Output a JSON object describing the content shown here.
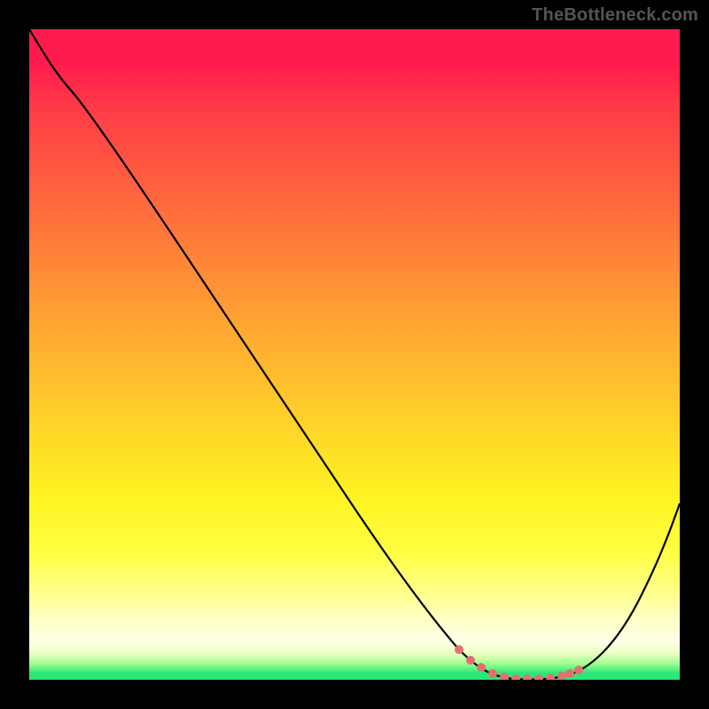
{
  "watermark": "TheBottleneck.com",
  "chart_data": {
    "type": "line",
    "title": "",
    "xlabel": "",
    "ylabel": "",
    "xlim": [
      0,
      100
    ],
    "ylim": [
      0,
      100
    ],
    "series": [
      {
        "name": "bottleneck-curve",
        "x": [
          0,
          5,
          10,
          20,
          30,
          40,
          50,
          60,
          66,
          70,
          74,
          78,
          82,
          85,
          90,
          95,
          100
        ],
        "values": [
          100,
          95,
          91,
          77,
          63,
          49,
          35,
          21,
          10,
          4,
          1,
          0,
          0,
          1,
          6,
          15,
          28
        ]
      }
    ],
    "marker_points": {
      "name": "optimal-range-markers",
      "x": [
        66,
        68,
        70,
        72,
        74,
        76,
        78,
        80,
        82,
        83,
        84,
        85
      ],
      "values": [
        7,
        5,
        4,
        2,
        1,
        1,
        0,
        0,
        0,
        1,
        1,
        2
      ]
    },
    "gradient_stops": [
      {
        "pos": 0,
        "color": "#ff1a4d"
      },
      {
        "pos": 50,
        "color": "#ffb92e"
      },
      {
        "pos": 80,
        "color": "#ffff40"
      },
      {
        "pos": 97,
        "color": "#a0ff90"
      },
      {
        "pos": 100,
        "color": "#28e878"
      }
    ],
    "marker_color": "#e27070"
  }
}
